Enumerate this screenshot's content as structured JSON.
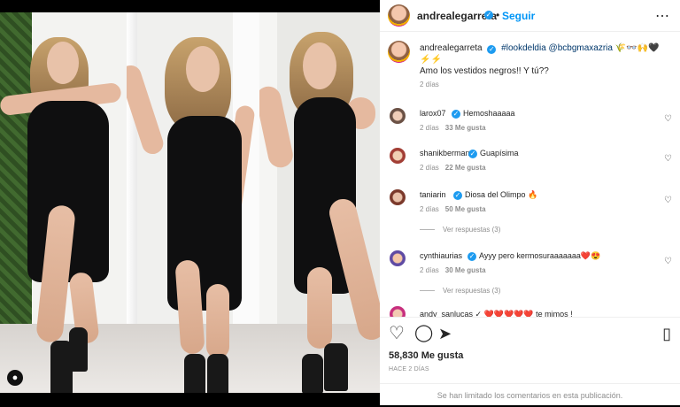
{
  "post": {
    "username": "andrealegarreta",
    "follow_label": "Seguir",
    "separator": "•",
    "more_label": "⋯"
  },
  "caption": {
    "username": "andrealegarreta",
    "text_prefix": "#lookdeldia @bcbgmaxazria 🌾👓🙌🖤",
    "line2": "⚡⚡",
    "line3": "Amo los vestidos negros!! Y tú??",
    "time": "2 días"
  },
  "comments": [
    {
      "user": "larox07",
      "text": "Hemoshaaaaa",
      "time": "2 días",
      "likes": "33 Me gusta"
    },
    {
      "user": "shanikberman",
      "text": "Guapísima",
      "time": "2 días",
      "likes": "22 Me gusta"
    },
    {
      "user": "taniarin",
      "text": "Diosa del Olimpo 🔥",
      "time": "2 días",
      "likes": "50 Me gusta",
      "replies": "Ver respuestas (3)"
    },
    {
      "user": "cynthiaurias",
      "text": "Ayyy pero kermosuraaaaaaa❤️😍",
      "time": "2 días",
      "likes": "30 Me gusta",
      "replies": "Ver respuestas (3)"
    }
  ],
  "partial_row": "andy_sanlucas ✓ ❤️❤️❤️❤️❤️ te mimos !",
  "actions": {
    "like_icon": "heart-icon",
    "comment_icon": "comment-icon",
    "share_icon": "share-icon",
    "save_icon": "bookmark-icon"
  },
  "likes": "58,830 Me gusta",
  "ago": "HACE 2 DÍAS",
  "comments_limited": "Se han limitado los comentarios en esta publicación.",
  "colors": {
    "accent": "#0095f6",
    "verified": "#1d9bf0",
    "muted": "#8e8e8e",
    "background": "#000000"
  }
}
